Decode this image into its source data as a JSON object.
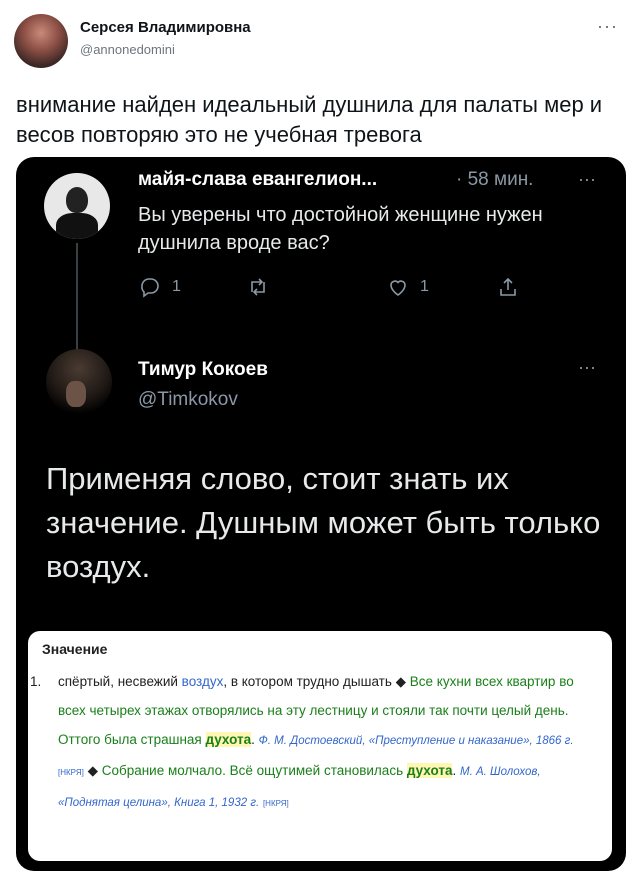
{
  "outer_tweet": {
    "author_name": "Серсея Владимировна",
    "author_handle": "@annonedomini",
    "more": "···",
    "text": "внимание найден идеальный душнила для палаты мер и весов повторяю это не учебная тревога"
  },
  "reply": {
    "name": "майя-слава евангелион...",
    "time": "· 58 мин.",
    "more": "···",
    "text": "Вы уверены что достойной женщине нужен душнила вроде вас?",
    "actions": {
      "reply_count": "1",
      "retweet_count": "",
      "like_count": "1"
    }
  },
  "main": {
    "name": "Тимур Кокоев",
    "handle": "@Timkokov",
    "more": "···",
    "text": "Применяя слово, стоит знать их значение. Душным может быть только воздух."
  },
  "dictionary": {
    "title": "Значение",
    "number": "1.",
    "p1": "спёртый, несвежий ",
    "link1": "воздух",
    "p2": ", в котором трудно дышать ◆ ",
    "g1": "Все кухни всех квартир во всех четырех этажах отворялись на эту лестницу и стояли так почти целый день. Оттого была страшная ",
    "hl1": "духота",
    "p3": ". ",
    "src1": "Ф. М. Достоевский, «Преступление и наказание», 1866 г.",
    "tag1": "[НКРЯ]",
    "p4": " ◆ ",
    "g2": "Собрание молчало. Всё ощутимей становилась ",
    "hl2": "духота",
    "p5": ". ",
    "src2": "М. А. Шолохов, «Поднятая целина», Книга 1, 1932 г.",
    "tag2": "[НКРЯ]"
  }
}
